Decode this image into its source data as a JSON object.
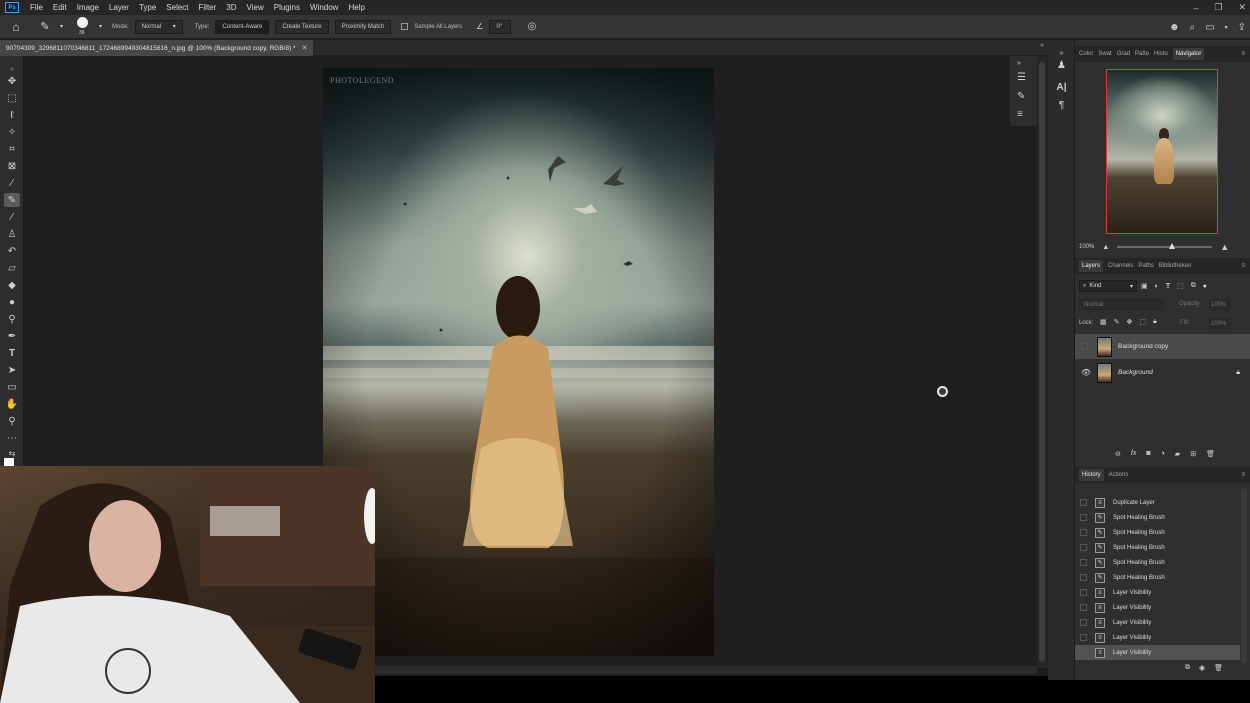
{
  "menubar": {
    "items": [
      "File",
      "Edit",
      "Image",
      "Layer",
      "Type",
      "Select",
      "Filter",
      "3D",
      "View",
      "Plugins",
      "Window",
      "Help"
    ]
  },
  "options": {
    "brush_size": "36",
    "mode_label": "Mode:",
    "mode_value": "Normal",
    "type_label": "Type:",
    "type_buttons": [
      "Content-Aware",
      "Create Texture",
      "Proximity Match"
    ],
    "sample_all_layers": "Sample All Layers",
    "angle": "0°"
  },
  "document": {
    "tab_title": "90704309_3296811070346811_1724689949304815616_n.jpg @ 100% (Background copy, RGB/8) *",
    "watermark": "PHOTOLEGEND"
  },
  "panels": {
    "top_tabs": [
      "Color",
      "Swat",
      "Grad",
      "Patte",
      "Histo",
      "Navigator"
    ],
    "zoom": "100%",
    "layer_tabs": [
      "Layers",
      "Channels",
      "Paths",
      "Bibliotheken"
    ],
    "kind_label": "Kind",
    "blend_mode": "Normal",
    "opacity_label": "Opacity:",
    "opacity": "100%",
    "lock_label": "Lock:",
    "fill_label": "Fill:",
    "fill": "100%",
    "layers": [
      {
        "name": "Background copy"
      },
      {
        "name": "Background"
      }
    ],
    "history_tabs": [
      "History",
      "Actions"
    ],
    "history": [
      "Duplicate Layer",
      "Spot Healing Brush",
      "Spot Healing Brush",
      "Spot Healing Brush",
      "Spot Healing Brush",
      "Spot Healing Brush",
      "Layer Visibility",
      "Layer Visibility",
      "Layer Visibility",
      "Layer Visibility",
      "Layer Visibility"
    ]
  },
  "icons": {
    "home": "home-icon",
    "search": "search-icon",
    "share": "share-icon"
  }
}
